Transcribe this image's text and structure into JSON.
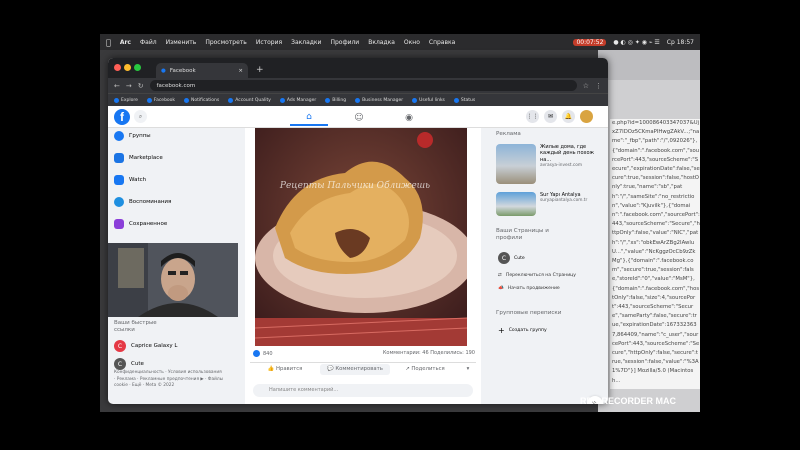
{
  "menubar": {
    "apple": "",
    "app": "Arc",
    "items": [
      "Файл",
      "Изменить",
      "Просмотреть",
      "История",
      "Закладки",
      "Профили",
      "Вкладка",
      "Окно",
      "Справка"
    ],
    "timer": "00:07:52",
    "clock": "Ср  18:57"
  },
  "browser": {
    "tab_title": "Facebook",
    "tab_close": "×",
    "new_tab": "+",
    "url": "facebook.com",
    "bookmarks": [
      "Explore",
      "Facebook",
      "Notifications",
      "Account Quality",
      "Ads Manager",
      "Billing",
      "Business Manager",
      "Useful links",
      "Status"
    ]
  },
  "facebook": {
    "logo": "f",
    "left_items": [
      {
        "label": "Группы",
        "icon": "groups-icon"
      },
      {
        "label": "Marketplace",
        "icon": "marketplace-icon"
      },
      {
        "label": "Watch",
        "icon": "watch-icon"
      },
      {
        "label": "Воспоминания",
        "icon": "memories-icon"
      },
      {
        "label": "Сохраненное",
        "icon": "saved-icon"
      }
    ],
    "shortcuts_title": "Ваши быстрые ссылки",
    "shortcuts": [
      {
        "label": "Caprice Galaxy L",
        "avatar": "C"
      },
      {
        "label": "Cute",
        "avatar": "C"
      }
    ],
    "footer": "Конфиденциальность · Условия использования · Реклама · Рекламные предпочтения ▶ · Файлы cookie · Ещё · Meta © 2022",
    "post": {
      "watermark": "Рецепты Пальчики Оближешь",
      "reactions_count": "840",
      "comments_shares": "Комментарии: 46  Поделились: 190",
      "like_label": "Нравится",
      "comment_label": "Комментировать",
      "share_label": "Поделиться",
      "comment_placeholder": "Напишите комментарий..."
    },
    "right": {
      "ads_title": "Реклама",
      "ads": [
        {
          "title": "Жилые дома, где каждый день похож на...",
          "source": "avrasya-invest.com"
        },
        {
          "title": "Sur Yapı Antalya",
          "source": "suryapiantalya.com.tr"
        }
      ],
      "pages_title": "Ваши Страницы и профили",
      "page_name": "Cute",
      "page_actions": [
        "Переключиться на Страницу",
        "Начать продвижение"
      ],
      "group_chats_title": "Групповые переписки",
      "create_group": "Создать группу"
    }
  },
  "cookie_text": "e.php?id=100086403347037&UjxZ7IDOz5CKmaPIHwgZAkV...;\"name\":\"_fbp\",\"path\":\"/\",092026\"},{\"domain\":\".facebook.com\",\"sourcePort\":443,\"sourceScheme\":\"Secure\",\"expirationDate\":false,\"secure\":true,\"session\":false,\"hostOnly\":true,\"name\":\"sb\",\"path\":\"/\",\"sameSite\":\"no_restriction\",\"value\":\"Kjuvilk\"},{\"domain\":\".facebook.com\",\"sourcePort\":443,\"sourceScheme\":\"Secure\",\"httpOnly\":false,\"value\":\"NIC\",\"path\":\"/\",\"xs\":\"obkEwArZBg2IAwluU...\",\"value\":\"NcKggzOcCb9zZkMg\"},{\"domain\":\".facebook.com\",\"secure\":true,\"session\":false,\"storeId\":\"0\",\"value\":\"MsM\"},{\"domain\":\".facebook.com\",\"hostOnly\":false,\"size\":4,\"sourcePort\":443,\"sourceScheme\":\"Secure\",\"sameParty\":false,\"secure\":true,\"expirationDate\":1673323637,864409,\"name\":\"c_user\",\"sourcePort\":443,\"sourceScheme\":\"Secure\",\"httpOnly\":false,\"secure\":true,\"session\":false,\"value\":\"%3A1%7D\"}]  Mozilla/5.0 (Macintosh...",
  "recorder_label": "REC RECORDER MAC",
  "colors": {
    "fb_blue": "#1877f2",
    "timer_red": "#c43d2a"
  }
}
